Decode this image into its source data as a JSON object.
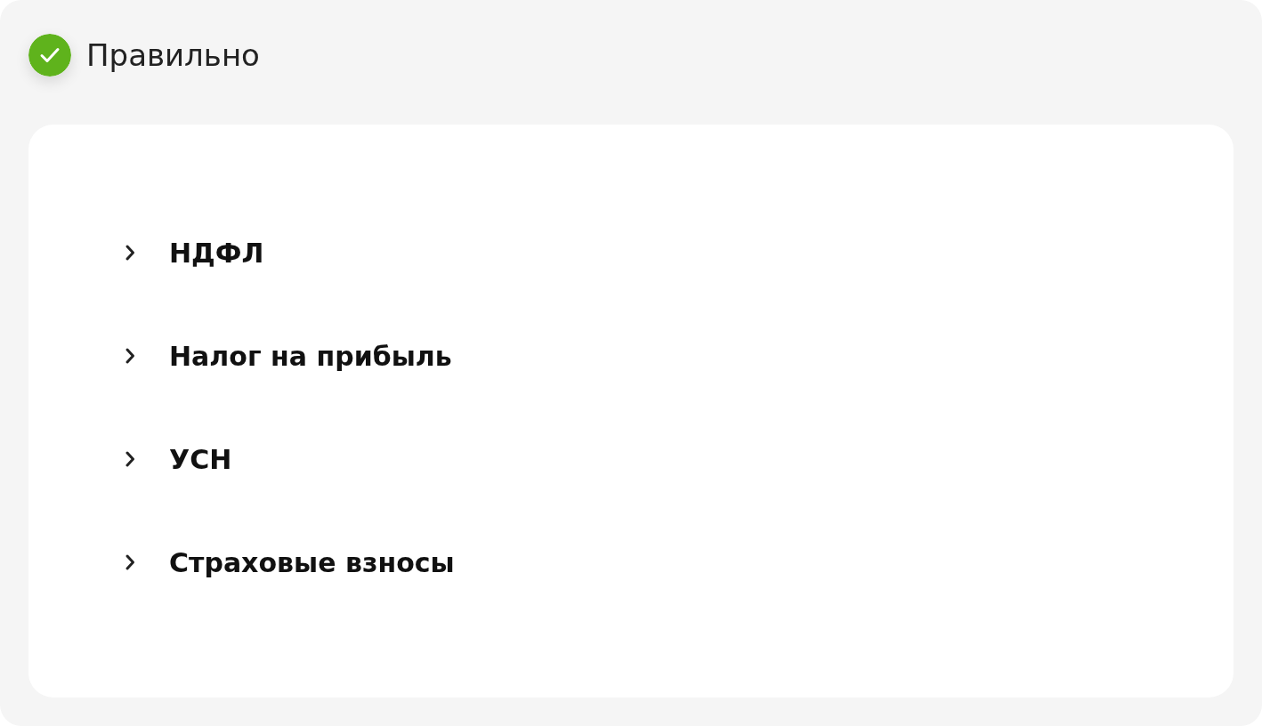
{
  "status": {
    "kind": "correct",
    "label": "Правильно"
  },
  "items": [
    {
      "label": "НДФЛ",
      "expanded": false
    },
    {
      "label": "Налог на прибыль",
      "expanded": false
    },
    {
      "label": "УСН",
      "expanded": false
    },
    {
      "label": "Страховые взносы",
      "expanded": false
    }
  ]
}
